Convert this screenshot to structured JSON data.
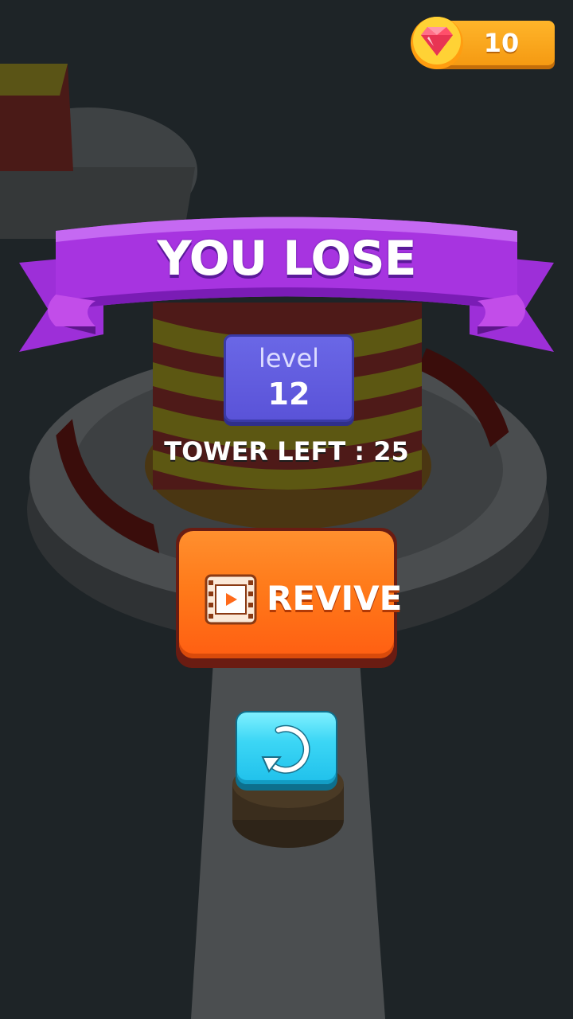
{
  "hud": {
    "gem_count": "10"
  },
  "result": {
    "title": "YOU LOSE",
    "level_label": "level",
    "level_number": "12",
    "tower_left": "TOWER LEFT : 25"
  },
  "buttons": {
    "revive_label": "REVIVE",
    "revive_icon": "video-film-icon",
    "restart_icon": "restart-icon"
  },
  "colors": {
    "ribbon": "#a734e0",
    "level_box": "#6461e2",
    "revive_button": "#ff7a1a",
    "restart_button": "#3cd6f5",
    "gem_bar": "#ffab22"
  }
}
